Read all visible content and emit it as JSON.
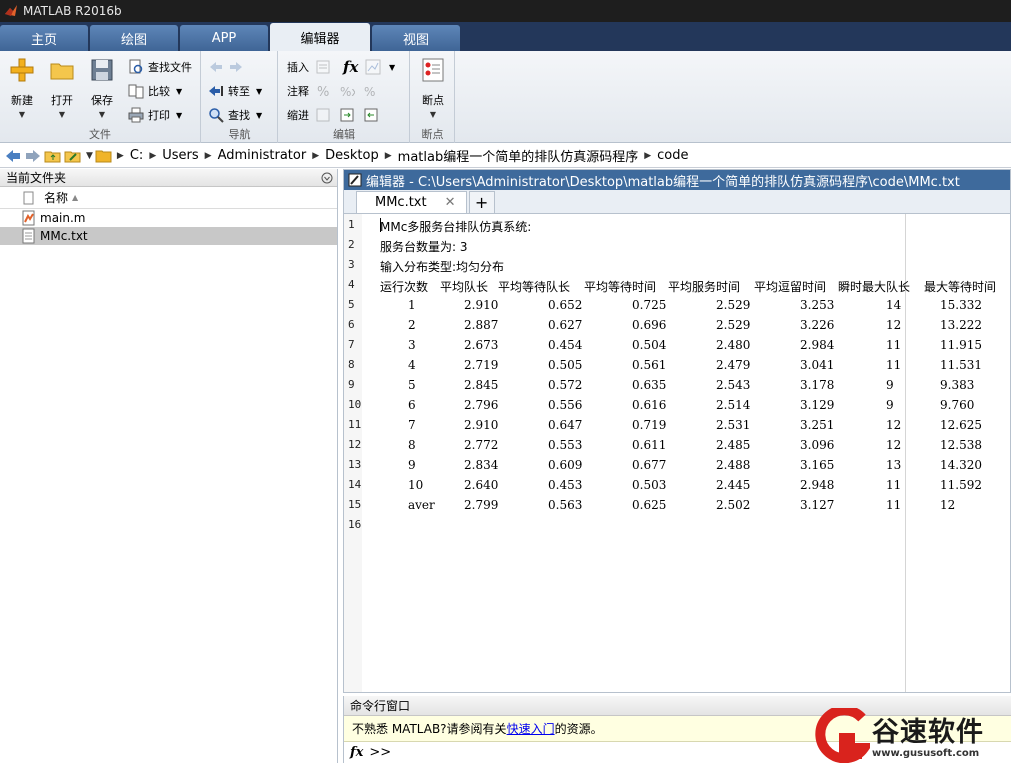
{
  "window": {
    "title": "MATLAB R2016b"
  },
  "ribbon_tabs": [
    {
      "label": "主页",
      "active": false
    },
    {
      "label": "绘图",
      "active": false
    },
    {
      "label": "APP",
      "active": false
    },
    {
      "label": "编辑器",
      "active": true
    },
    {
      "label": "视图",
      "active": false
    }
  ],
  "ribbon": {
    "file_group": {
      "label": "文件",
      "new": "新建",
      "open": "打开",
      "save": "保存",
      "find_files": "查找文件",
      "compare": "比较",
      "print": "打印"
    },
    "nav_group": {
      "label": "导航",
      "goto": "转至",
      "find": "查找"
    },
    "edit_group": {
      "label": "编辑",
      "insert": "插入",
      "comment": "注释",
      "indent": "缩进",
      "fx": "fx"
    },
    "breakpoints_group": {
      "label": "断点",
      "breakpoints": "断点"
    }
  },
  "address": {
    "crumbs": [
      "C:",
      "Users",
      "Administrator",
      "Desktop",
      "matlab编程一个简单的排队仿真源码程序",
      "code"
    ]
  },
  "current_folder": {
    "title": "当前文件夹",
    "column_name": "名称",
    "sort_indicator": "▲",
    "files": [
      {
        "name": "main.m",
        "selected": false
      },
      {
        "name": "MMc.txt",
        "selected": true
      }
    ]
  },
  "editor": {
    "title": "编辑器 - C:\\Users\\Administrator\\Desktop\\matlab编程一个简单的排队仿真源码程序\\code\\MMc.txt",
    "tab": "MMc.txt",
    "tab_close": "✕",
    "tab_add": "+",
    "lines": [
      "MMc多服务台排队仿真系统:",
      "服务台数量为: 3",
      "输入分布类型:均匀分布"
    ],
    "table_headers": [
      "运行次数",
      "平均队长",
      "平均等待队长",
      "平均等待时间",
      "平均服务时间",
      "平均逗留时间",
      "瞬时最大队长",
      "最大等待时间"
    ],
    "table_rows": [
      [
        "1",
        "2.910",
        "0.652",
        "0.725",
        "2.529",
        "3.253",
        "14",
        "15.332"
      ],
      [
        "2",
        "2.887",
        "0.627",
        "0.696",
        "2.529",
        "3.226",
        "12",
        "13.222"
      ],
      [
        "3",
        "2.673",
        "0.454",
        "0.504",
        "2.480",
        "2.984",
        "11",
        "11.915"
      ],
      [
        "4",
        "2.719",
        "0.505",
        "0.561",
        "2.479",
        "3.041",
        "11",
        "11.531"
      ],
      [
        "5",
        "2.845",
        "0.572",
        "0.635",
        "2.543",
        "3.178",
        "9",
        "9.383"
      ],
      [
        "6",
        "2.796",
        "0.556",
        "0.616",
        "2.514",
        "3.129",
        "9",
        "9.760"
      ],
      [
        "7",
        "2.910",
        "0.647",
        "0.719",
        "2.531",
        "3.251",
        "12",
        "12.625"
      ],
      [
        "8",
        "2.772",
        "0.553",
        "0.611",
        "2.485",
        "3.096",
        "12",
        "12.538"
      ],
      [
        "9",
        "2.834",
        "0.609",
        "0.677",
        "2.488",
        "3.165",
        "13",
        "14.320"
      ],
      [
        "10",
        "2.640",
        "0.453",
        "0.503",
        "2.445",
        "2.948",
        "11",
        "11.592"
      ],
      [
        "aver",
        "2.799",
        "0.563",
        "0.625",
        "2.502",
        "3.127",
        "11",
        "12"
      ]
    ],
    "line_numbers": [
      "1",
      "2",
      "3",
      "4",
      "5",
      "6",
      "7",
      "8",
      "9",
      "10",
      "11",
      "12",
      "13",
      "14",
      "15",
      "16"
    ]
  },
  "command_window": {
    "title": "命令行窗口",
    "notice_prefix": "不熟悉 MATLAB?请参阅有关",
    "notice_link": "快速入门",
    "notice_suffix": "的资源。",
    "fx": "fx",
    "prompt": ">>"
  },
  "watermark": {
    "text": "谷速软件",
    "url": "www.gususoft.com"
  },
  "colors": {
    "tabbar": "#23375a",
    "editor_title": "#3e6a9c",
    "notice_bg": "#ffffe1",
    "watermark_red": "#d9231d"
  }
}
